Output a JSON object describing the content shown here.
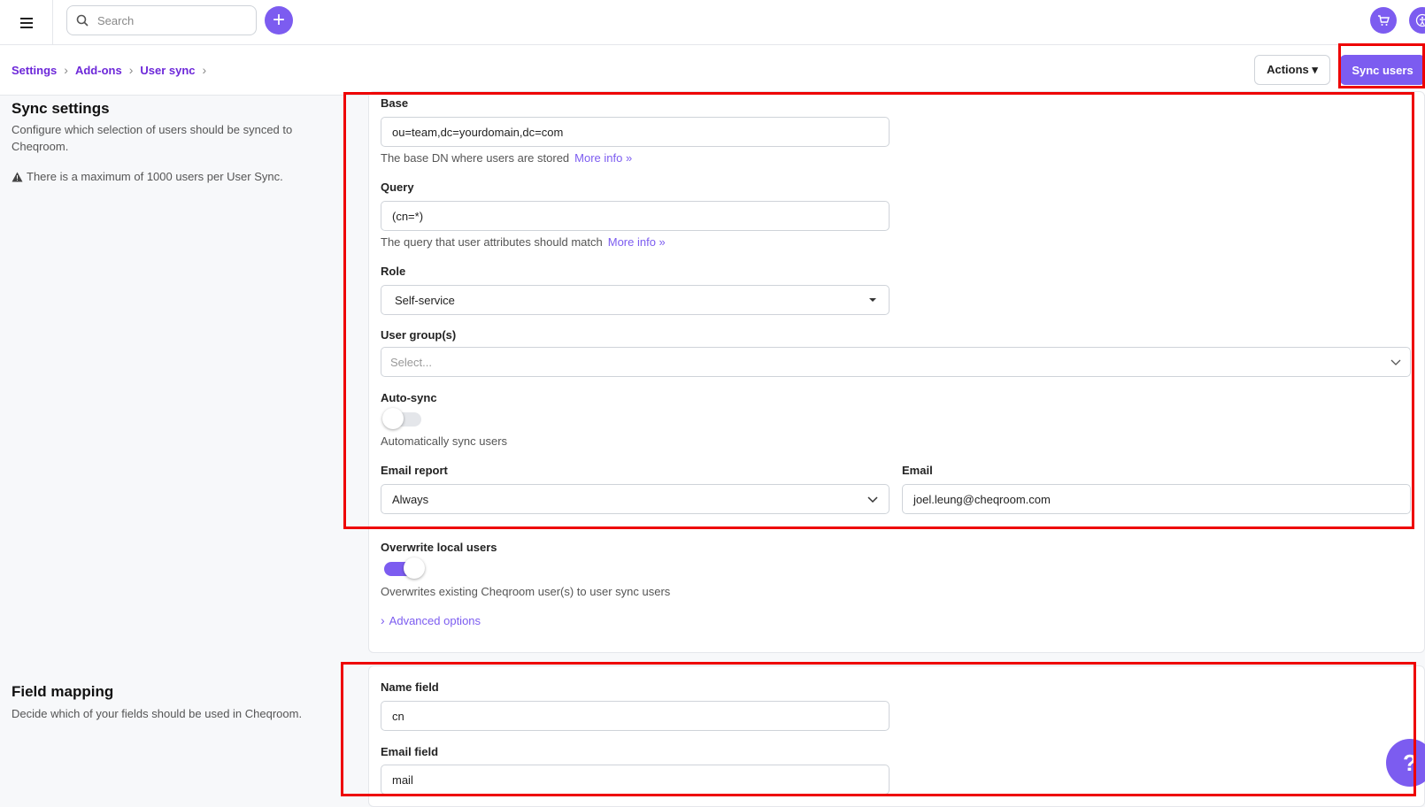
{
  "topbar": {
    "search_placeholder": "Search"
  },
  "breadcrumb": {
    "items": [
      "Settings",
      "Add-ons",
      "User sync"
    ]
  },
  "header_actions": {
    "actions_label": "Actions ▾",
    "sync_label": "Sync users"
  },
  "sync_settings": {
    "title": "Sync settings",
    "description": "Configure which selection of users should be synced to Cheqroom.",
    "warning": "There is a maximum of 1000 users per User Sync."
  },
  "form": {
    "base_label": "Base",
    "base_value": "ou=team,dc=yourdomain,dc=com",
    "base_help": "The base DN where users are stored",
    "query_label": "Query",
    "query_value": "(cn=*)",
    "query_help": "The query that user attributes should match",
    "more_info": "More info »",
    "role_label": "Role",
    "role_value": "Self-service",
    "groups_label": "User group(s)",
    "groups_placeholder": "Select...",
    "autosync_label": "Auto-sync",
    "autosync_on": false,
    "autosync_help": "Automatically sync users",
    "email_report_label": "Email report",
    "email_report_value": "Always",
    "email_label": "Email",
    "email_value": "joel.leung@cheqroom.com",
    "overwrite_label": "Overwrite local users",
    "overwrite_on": true,
    "overwrite_help": "Overwrites existing Cheqroom user(s) to user sync users",
    "advanced_label": "Advanced options"
  },
  "field_mapping": {
    "title": "Field mapping",
    "description": "Decide which of your fields should be used in Cheqroom.",
    "name_label": "Name field",
    "name_value": "cn",
    "email_label": "Email field",
    "email_value": "mail"
  },
  "colors": {
    "accent": "#7c5cf0",
    "highlight": "#e00000"
  }
}
